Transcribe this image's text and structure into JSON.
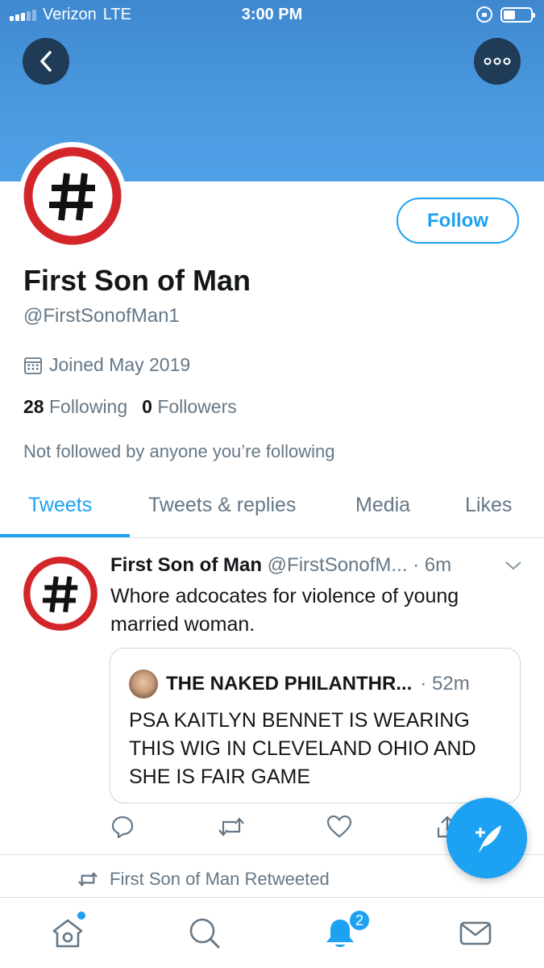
{
  "status_bar": {
    "carrier": "Verizon",
    "network": "LTE",
    "time": "3:00 PM"
  },
  "profile": {
    "name": "First Son of Man",
    "handle": "@FirstSonofMan1",
    "joined": "Joined May 2019",
    "following_count": "28",
    "following_label": "Following",
    "followers_count": "0",
    "followers_label": "Followers",
    "not_followed": "Not followed by anyone you’re following",
    "follow_label": "Follow"
  },
  "tabs": [
    {
      "label": "Tweets",
      "active": true
    },
    {
      "label": "Tweets & replies",
      "active": false
    },
    {
      "label": "Media",
      "active": false
    },
    {
      "label": "Likes",
      "active": false
    }
  ],
  "tweet": {
    "name": "First Son of Man",
    "handle": "@FirstSonofM...",
    "time": "· 6m",
    "text": "Whore adcocates for violence of young married woman.",
    "quote": {
      "name": "THE NAKED PHILANTHR...",
      "time": "· 52m",
      "text": "PSA KAITLYN BENNET IS WEARING THIS WIG IN CLEVELAND OHIO AND SHE IS FAIR GAME"
    }
  },
  "retweeted_label": "First Son of Man Retweeted",
  "notifications_badge": "2",
  "icons": {
    "back": "chevron-left-icon",
    "more": "more-options-icon",
    "calendar": "calendar-icon",
    "reply": "reply-icon",
    "retweet": "retweet-icon",
    "like": "heart-icon",
    "share": "share-icon",
    "compose": "compose-tweet-icon",
    "home": "home-icon",
    "search": "search-icon",
    "notifications": "bell-icon",
    "messages": "mail-icon"
  },
  "colors": {
    "accent": "#1da1f2",
    "banner": "#4a9ae0",
    "avatar_ring": "#d3262b"
  }
}
